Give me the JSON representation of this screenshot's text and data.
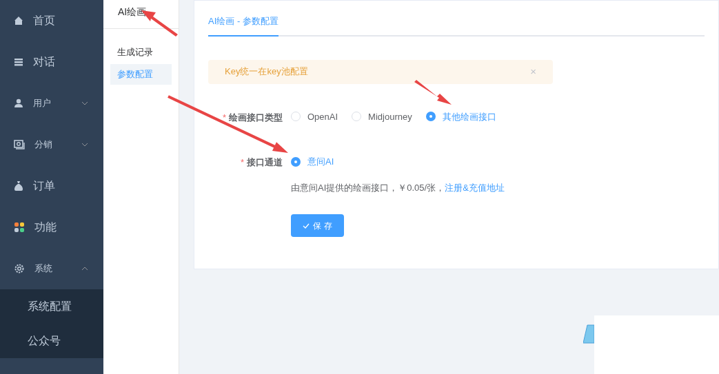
{
  "sidebar": {
    "items": [
      {
        "label": "首页",
        "kind": "link"
      },
      {
        "label": "对话",
        "kind": "link"
      },
      {
        "label": "用户",
        "kind": "group",
        "expanded": false
      },
      {
        "label": "分销",
        "kind": "group",
        "expanded": false
      },
      {
        "label": "订单",
        "kind": "link"
      },
      {
        "label": "功能",
        "kind": "link"
      },
      {
        "label": "系统",
        "kind": "group",
        "expanded": true,
        "children": [
          {
            "label": "系统配置"
          },
          {
            "label": "公众号"
          }
        ]
      }
    ]
  },
  "submenu": {
    "title": "AI绘画",
    "items": [
      {
        "label": "生成记录",
        "selected": false
      },
      {
        "label": "参数配置",
        "selected": true
      }
    ]
  },
  "tabs": [
    {
      "label": "AI绘画 - 参数配置",
      "selected": true
    }
  ],
  "alert": {
    "text": "Key统一在key池配置",
    "close": "×"
  },
  "form": {
    "fields": [
      {
        "label": "绘画接口类型",
        "required_mark": "*",
        "options": [
          {
            "label": "OpenAI",
            "selected": false
          },
          {
            "label": "Midjourney",
            "selected": false
          },
          {
            "label": "其他绘画接口",
            "selected": true
          }
        ]
      },
      {
        "label": "接口通道",
        "required_mark": "*",
        "options": [
          {
            "label": "意间AI",
            "selected": true
          }
        ],
        "help": "由意间AI提供的绘画接口，￥0.05/张，",
        "help_link": "注册&充值地址"
      }
    ]
  },
  "save_button": "保 存"
}
